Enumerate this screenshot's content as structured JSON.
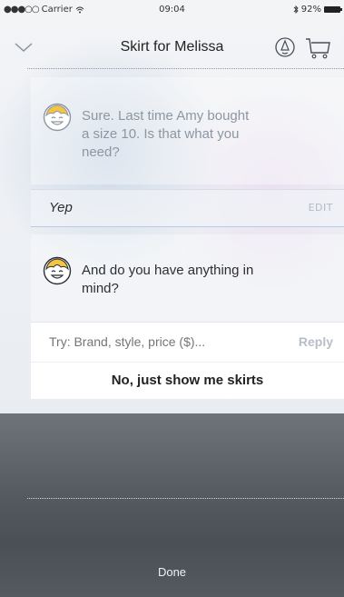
{
  "status_bar": {
    "signal": "●●●○○",
    "carrier": "Carrier",
    "time": "09:04",
    "battery": "92%"
  },
  "nav": {
    "title": "Skirt for Melissa",
    "back_icon": "chevron-down-icon",
    "badge_icon": "profile-badge-icon",
    "cart_icon": "cart-icon"
  },
  "chat": {
    "bot_message_1": {
      "line1": "Sure. Last time Amy bought",
      "line2": "a size 10. Is that what you",
      "line3": "need?"
    },
    "user_answer": "Yep",
    "edit_label": "EDIT",
    "bot_message_2": {
      "line1": "And do you have anything in",
      "line2": "mind?"
    },
    "input_placeholder": "Try: Brand, style, price ($)...",
    "reply_label": "Reply",
    "suggestion": "No, just show me skirts"
  },
  "keyboard": {
    "done_label": "Done"
  },
  "colors": {
    "accent_yellow": "#f5c542",
    "muted_text": "#8d96a1"
  }
}
